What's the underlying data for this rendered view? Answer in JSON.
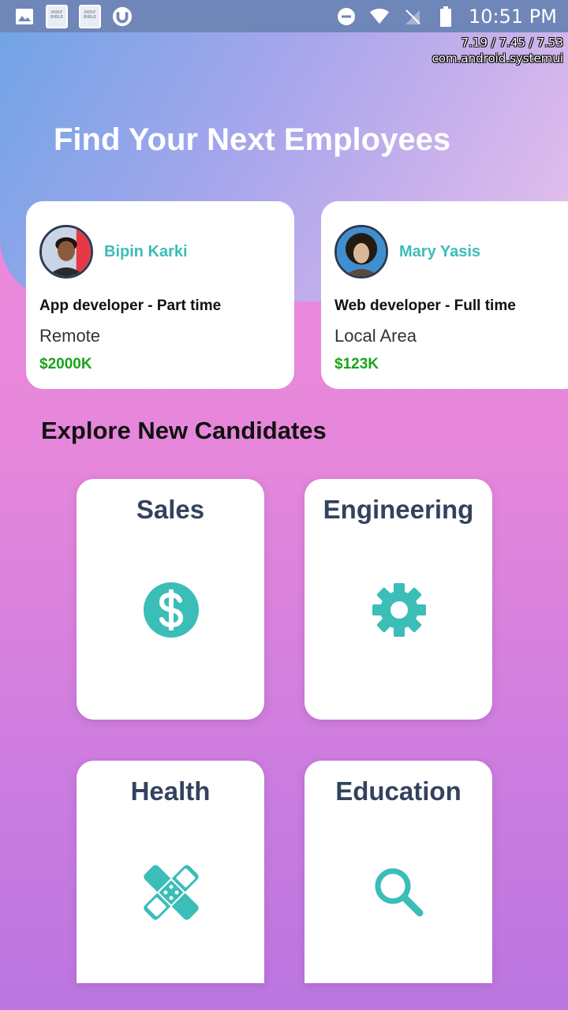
{
  "status_bar": {
    "time": "10:51 PM",
    "bible_icon_text": "HOLY BIBLE",
    "debug_line1": "7.19 / 7.45 / 7.53",
    "debug_line2": "com.android.systemui"
  },
  "header": {
    "title": "Find Your Next Employees"
  },
  "jobs": [
    {
      "name": "Bipin Karki",
      "title": "App developer - Part time",
      "location": "Remote",
      "pay": "$2000K"
    },
    {
      "name": "Mary Yasis",
      "title": "Web developer - Full time",
      "location": "Local Area",
      "pay": "$123K"
    }
  ],
  "explore": {
    "title": "Explore New Candidates",
    "categories": [
      {
        "label": "Sales",
        "icon": "dollar-icon"
      },
      {
        "label": "Engineering",
        "icon": "gear-icon"
      },
      {
        "label": "Health",
        "icon": "bandage-icon"
      },
      {
        "label": "Education",
        "icon": "search-icon"
      }
    ]
  },
  "colors": {
    "accent": "#3bbdb8",
    "pay": "#1aa31a",
    "category_text": "#33425e"
  }
}
